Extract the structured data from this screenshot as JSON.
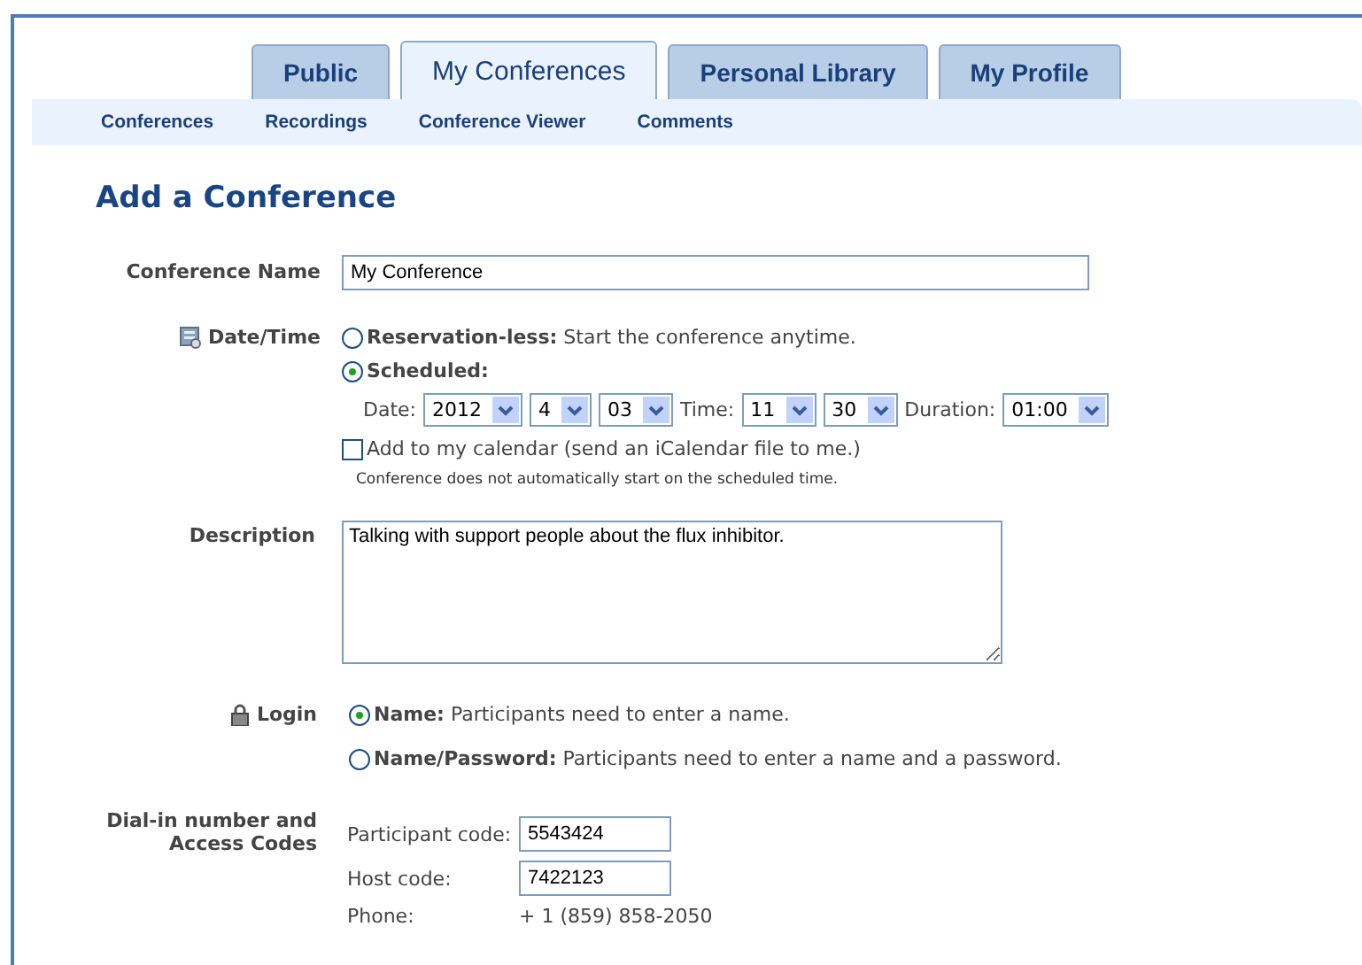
{
  "tabs": [
    {
      "label": "Public",
      "selected": false
    },
    {
      "label": "My Conferences",
      "selected": true
    },
    {
      "label": "Personal Library",
      "selected": false
    },
    {
      "label": "My Profile",
      "selected": false
    }
  ],
  "subnav": [
    "Conferences",
    "Recordings",
    "Conference Viewer",
    "Comments"
  ],
  "heading": "Add a Conference",
  "conference_name": {
    "label": "Conference Name",
    "value": "My Conference"
  },
  "date_time": {
    "label": "Date/Time",
    "options": [
      {
        "title": "Reservation-less:",
        "text": "Start the conference anytime.",
        "selected": false
      },
      {
        "title": "Scheduled:",
        "selected": true
      }
    ],
    "fields": [
      {
        "label": "Date:",
        "value": "2012"
      },
      {
        "value": "4"
      },
      {
        "value": "03"
      },
      {
        "label": "Time:",
        "value": "11"
      },
      {
        "value": "30"
      },
      {
        "label": "Duration:",
        "value": "01:00"
      }
    ],
    "calendar": {
      "label": "Add to my calendar (send an iCalendar file to me.)",
      "checked": false
    },
    "note": "Conference does not automatically start on the scheduled time."
  },
  "description": {
    "label": "Description",
    "value": "Talking with support people about the flux inhibitor."
  },
  "login": {
    "label": "Login",
    "options": [
      {
        "title": "Name:",
        "text": "Participants need to enter a name.",
        "selected": true
      },
      {
        "title": "Name/Password:",
        "text": "Participants need to enter a name and a password.",
        "selected": false
      }
    ]
  },
  "dial_in": {
    "label": "Dial-in number and Access Codes",
    "rows": [
      {
        "kind": "input",
        "label": "Participant code:",
        "value": "5543424"
      },
      {
        "kind": "input",
        "label": "Host code:",
        "value": "7422123"
      },
      {
        "kind": "text",
        "label": "Phone:",
        "value": "+ 1 (859) 858-2050"
      }
    ]
  }
}
